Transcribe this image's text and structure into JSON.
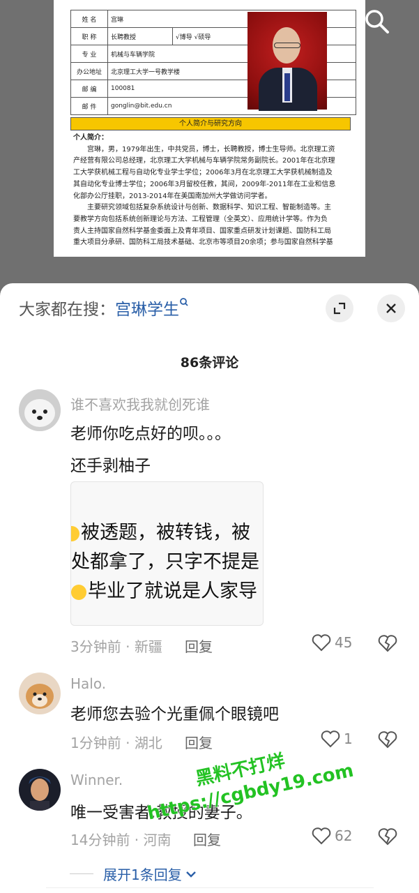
{
  "document": {
    "rows": [
      {
        "key": "姓  名",
        "value": "宫琳"
      },
      {
        "key": "职  称",
        "value": "长聘教授",
        "extra": "√博导 √硕导"
      },
      {
        "key": "专  业",
        "value": "机械与车辆学院"
      },
      {
        "key": "办公地址",
        "value": "北京理工大学一号教学楼"
      },
      {
        "key": "邮  编",
        "value": "100081"
      },
      {
        "key": "邮  件",
        "value": "gonglin@bit.edu.cn"
      }
    ],
    "section_title": "个人简介与研究方向",
    "bio_heading": "个人简介：",
    "bio_lines": [
      "宫琳，男，1979年出生，中共党员，博士，长聘教授，博士生导师。北京理工资",
      "产经营有限公司总经理，北京理工大学机械与车辆学院常务副院长。2001年在北京理",
      "工大学获机械工程与自动化专业学士学位；2006年3月在北京理工大学获机械制造及",
      "其自动化专业博士学位；2006年3月留校任教，其间，2009年-2011年在工业和信息",
      "化部办公厅挂职，2013-2014年在美国南加州大学做访问学者。",
      "主要研究领域包括复杂系统设计与创新、数据科学、知识工程、智能制造等。主",
      "要教学方向包括系统创新理论与方法、工程管理（全英文）、应用统计学等。作为负",
      "责人主持国家自然科学基金委面上及青年项目、国家重点研发计划课题、国防科工局",
      "重大项目分承研、国防科工局技术基础、北京市等项目20余项；参与国家自然科学基"
    ]
  },
  "search": {
    "prefix": "大家都在搜：",
    "query": "宫琳学生"
  },
  "comments_count": "86条评论",
  "comments": [
    {
      "name": "谁不喜欢我我就创死谁",
      "lines": [
        "老师你吃点好的呗。。。",
        "还手剥柚子"
      ],
      "image_lines": [
        "被透题，被转钱，被",
        "处都拿了，只字不提是",
        "毕业了就说是人家导"
      ],
      "time": "3分钟前",
      "location": "新疆",
      "reply": "回复",
      "likes": "45"
    },
    {
      "name": "Halo.",
      "lines": [
        "老师您去验个光重佩个眼镜吧"
      ],
      "time": "1分钟前",
      "location": "湖北",
      "reply": "回复",
      "likes": "1"
    },
    {
      "name": "Winner.",
      "lines": [
        "唯一受害者:教授的妻子。"
      ],
      "time": "14分钟前",
      "location": "河南",
      "reply": "回复",
      "likes": "62"
    }
  ],
  "expand_label": "展开1条回复",
  "watermark": {
    "line1": "黑料不打烊",
    "line2": "https://cgbdy19.com"
  },
  "colors": {
    "accent": "#2a5fa8",
    "yellow": "#f7c600",
    "watermark": "#23c223"
  }
}
